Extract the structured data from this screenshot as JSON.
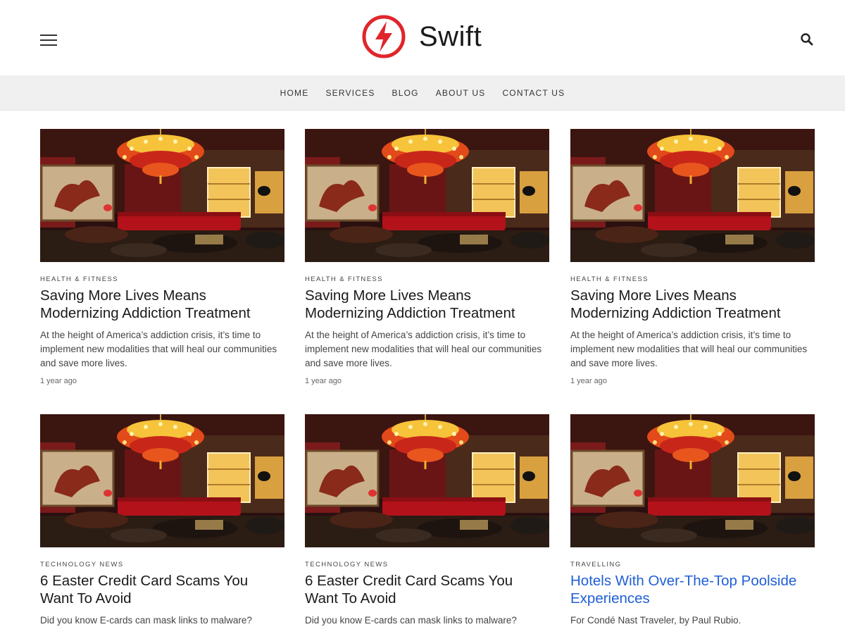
{
  "header": {
    "logo_text": "Swift",
    "brand_color": "#e0262b"
  },
  "nav": {
    "items": [
      {
        "label": "HOME"
      },
      {
        "label": "SERVICES"
      },
      {
        "label": "BLOG"
      },
      {
        "label": "ABOUT US"
      },
      {
        "label": "CONTACT US"
      }
    ]
  },
  "posts": [
    {
      "category": "HEALTH & FITNESS",
      "title": "Saving More Lives Means Modernizing Addiction Treatment",
      "excerpt": "At the height of America’s addiction crisis, it’s time to implement new modalities that will heal our communities and save more lives.",
      "meta": "1 year ago"
    },
    {
      "category": "HEALTH & FITNESS",
      "title": "Saving More Lives Means Modernizing Addiction Treatment",
      "excerpt": "At the height of America’s addiction crisis, it’s time to implement new modalities that will heal our communities and save more lives.",
      "meta": "1 year ago"
    },
    {
      "category": "HEALTH & FITNESS",
      "title": "Saving More Lives Means Modernizing Addiction Treatment",
      "excerpt": "At the height of America’s addiction crisis, it’s time to implement new modalities that will heal our communities and save more lives.",
      "meta": "1 year ago"
    },
    {
      "category": "TECHNOLOGY NEWS",
      "title": "6 Easter Credit Card Scams You Want To Avoid",
      "excerpt": "Did you know E-cards can mask links to malware?",
      "meta": ""
    },
    {
      "category": "TECHNOLOGY NEWS",
      "title": "6 Easter Credit Card Scams You Want To Avoid",
      "excerpt": "Did you know E-cards can mask links to malware?",
      "meta": ""
    },
    {
      "category": "TRAVELLING",
      "title": "Hotels With Over-The-Top Poolside Experiences",
      "excerpt": "For Condé Nast Traveler, by Paul Rubio.",
      "meta": ""
    }
  ]
}
